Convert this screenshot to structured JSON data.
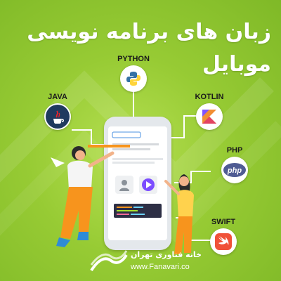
{
  "title": {
    "line1": "زبان های برنامه نویسی",
    "line2": "موبایل"
  },
  "languages": [
    {
      "id": "python",
      "label": "PYTHON"
    },
    {
      "id": "java",
      "label": "JAVA"
    },
    {
      "id": "kotlin",
      "label": "KOTLIN"
    },
    {
      "id": "php",
      "label": "PHP",
      "icon_text": "php"
    },
    {
      "id": "swift",
      "label": "SWIFT"
    }
  ],
  "footer": {
    "brand": "خانه فناوری تهران",
    "website": "www.Fanavari.co"
  },
  "colors": {
    "background": "#97cb34",
    "accent": "#f7941d",
    "video": "#7c4dff",
    "python_blue": "#3572a5",
    "python_yellow": "#ffd43b",
    "kotlin": "#f18e33",
    "php": "#4f5b93",
    "swift": "#f05138"
  }
}
